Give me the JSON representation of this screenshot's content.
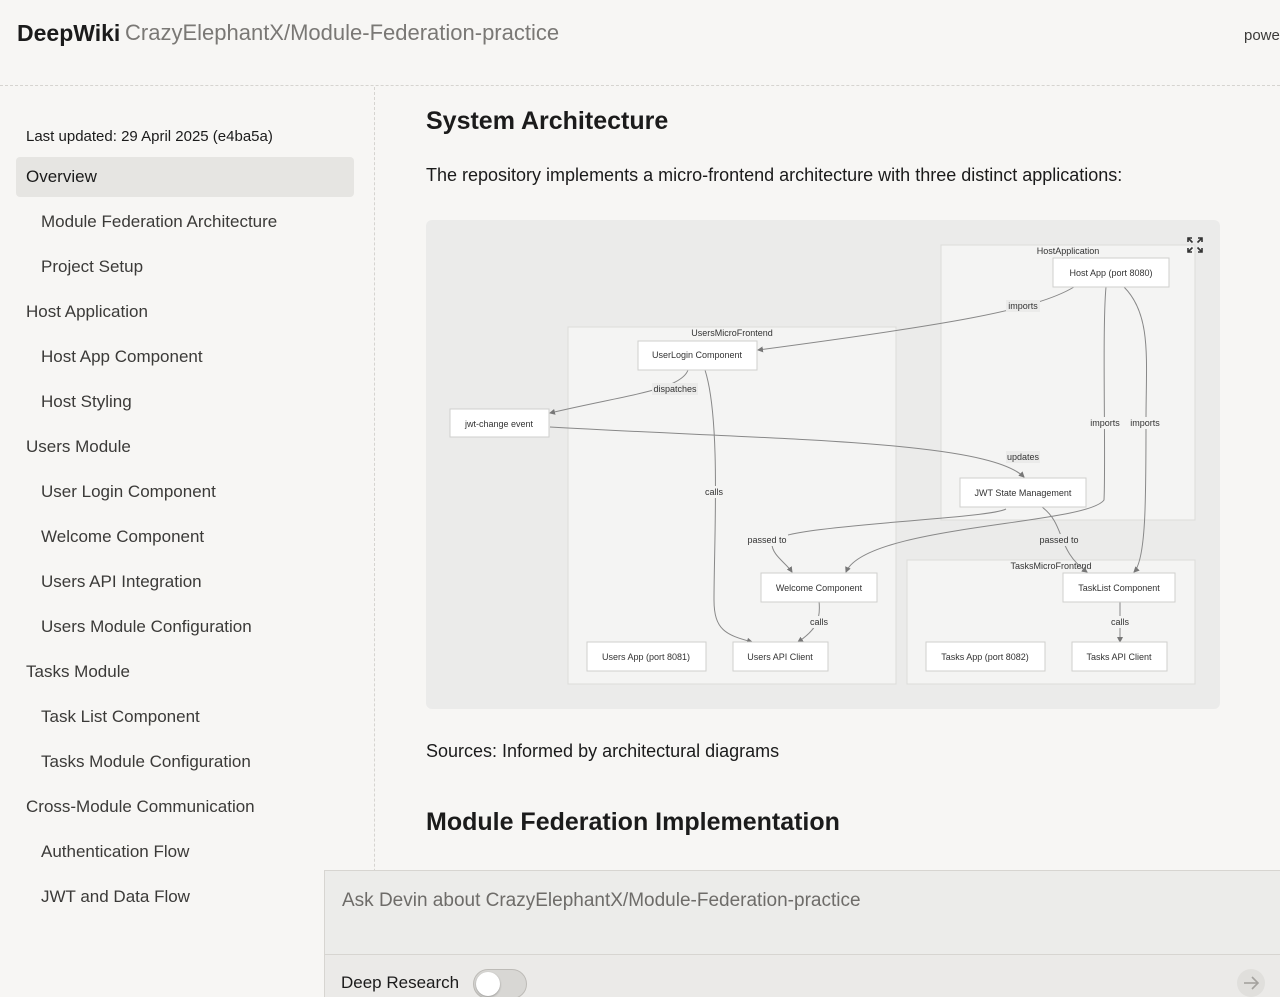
{
  "header": {
    "brand": "DeepWiki",
    "repo": "CrazyElephantX/Module-Federation-practice",
    "powered": "powe"
  },
  "sidebar": {
    "last_updated": "Last updated: 29 April 2025 (e4ba5a)",
    "items": [
      {
        "label": "Overview",
        "level": 0,
        "active": true
      },
      {
        "label": "Module Federation Architecture",
        "level": 1
      },
      {
        "label": "Project Setup",
        "level": 1
      },
      {
        "label": "Host Application",
        "level": 0
      },
      {
        "label": "Host App Component",
        "level": 1
      },
      {
        "label": "Host Styling",
        "level": 1
      },
      {
        "label": "Users Module",
        "level": 0
      },
      {
        "label": "User Login Component",
        "level": 1
      },
      {
        "label": "Welcome Component",
        "level": 1
      },
      {
        "label": "Users API Integration",
        "level": 1
      },
      {
        "label": "Users Module Configuration",
        "level": 1
      },
      {
        "label": "Tasks Module",
        "level": 0
      },
      {
        "label": "Task List Component",
        "level": 1
      },
      {
        "label": "Tasks Module Configuration",
        "level": 1
      },
      {
        "label": "Cross-Module Communication",
        "level": 0
      },
      {
        "label": "Authentication Flow",
        "level": 1
      },
      {
        "label": "JWT and Data Flow",
        "level": 1
      }
    ]
  },
  "main": {
    "section1_title": "System Architecture",
    "intro": "The repository implements a micro-frontend architecture with three distinct applications:",
    "sources": "Sources: Informed by architectural diagrams",
    "section2_title": "Module Federation Implementation"
  },
  "diagram": {
    "groups": {
      "host": "HostApplication",
      "users": "UsersMicroFrontend",
      "tasks": "TasksMicroFrontend"
    },
    "nodes": {
      "host_app": "Host App (port 8080)",
      "user_login": "UserLogin Component",
      "jwt_event": "jwt-change event",
      "jwt_state": "JWT State Management",
      "welcome": "Welcome Component",
      "tasklist": "TaskList Component",
      "users_app": "Users App (port 8081)",
      "users_api": "Users API Client",
      "tasks_app": "Tasks App (port 8082)",
      "tasks_api": "Tasks API Client"
    },
    "edges": {
      "imports_login": "imports",
      "imports_welcome": "imports",
      "imports_tasklist": "imports",
      "dispatches": "dispatches",
      "updates": "updates",
      "calls_users": "calls",
      "passed_welcome": "passed to",
      "passed_tasklist": "passed to",
      "calls_welcome": "calls",
      "calls_tasks": "calls"
    }
  },
  "ask": {
    "placeholder": "Ask Devin about CrazyElephantX/Module-Federation-practice",
    "deep_research": "Deep Research",
    "deep_research_on": false
  },
  "icons": {
    "expand": "expand-icon",
    "send": "arrow-right-icon"
  }
}
